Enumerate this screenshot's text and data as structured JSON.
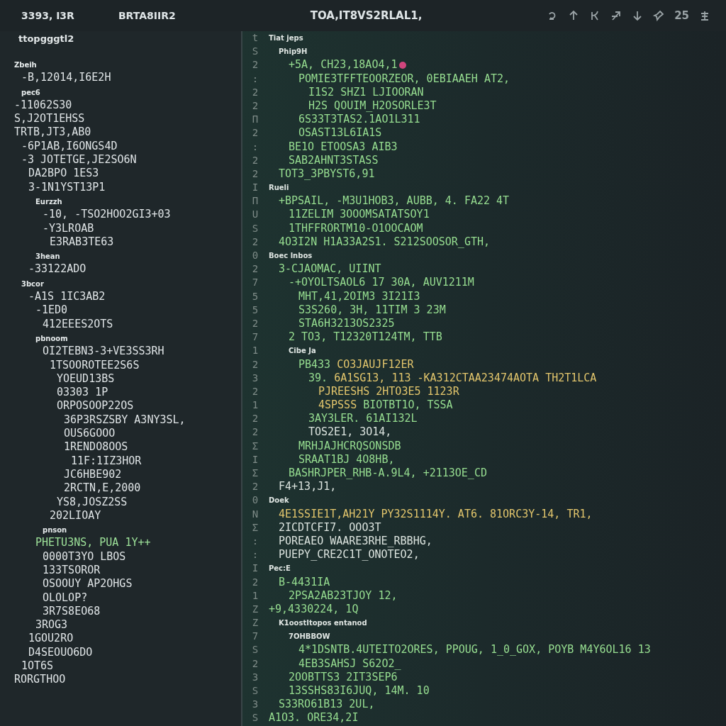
{
  "header": {
    "project": "3393, I3R",
    "branch": "BRTA8IIR2",
    "title": "TOA,IT8VS2RLAL1,",
    "count": "25"
  },
  "sidebar": {
    "subtitle": "ttopgggtl2",
    "items": [
      {
        "text": "Zbeih",
        "kind": "heading",
        "children": [
          {
            "text": "-B,12014,I6E2H",
            "kind": "line"
          },
          {
            "text": "pec6",
            "kind": "heading"
          }
        ]
      },
      {
        "text": "-11062S30",
        "kind": "line"
      },
      {
        "text": "S,J2OT1EHSS",
        "kind": "line"
      },
      {
        "text": "TRTB,JT3,AB0",
        "kind": "line",
        "children": [
          {
            "text": "-6P1AB,I6ONGS4D",
            "kind": "line"
          },
          {
            "text": "-3 JOTETGE,JE2SO6N",
            "kind": "line",
            "children": [
              {
                "text": "DA2BPO 1ES3",
                "kind": "line"
              },
              {
                "text": "3-1N1YST13P1",
                "kind": "line",
                "children": [
                  {
                    "text": "Eurzzh",
                    "kind": "heading",
                    "children": [
                      {
                        "text": "-10, -TSO2HOO2GI3+03",
                        "kind": "line"
                      },
                      {
                        "text": "-Y3LROAB",
                        "kind": "line",
                        "children": [
                          {
                            "text": "E3RAB3TE63",
                            "kind": "line"
                          }
                        ]
                      }
                    ]
                  },
                  {
                    "text": "3hean",
                    "kind": "heading"
                  }
                ]
              },
              {
                "text": "-33122ADO",
                "kind": "line"
              }
            ]
          },
          {
            "text": "3bcor",
            "kind": "heading",
            "children": [
              {
                "text": "-A1S 1IC3AB2",
                "kind": "line",
                "children": [
                  {
                    "text": "-1ED0",
                    "kind": "line",
                    "children": [
                      {
                        "text": "412EEES2OTS",
                        "kind": "line"
                      }
                    ]
                  },
                  {
                    "text": "pbnoom",
                    "kind": "heading",
                    "children": [
                      {
                        "text": "OI2TEBN3-3+VE3SS3RH",
                        "kind": "line",
                        "children": [
                          {
                            "text": "1TSOOROTEE2S6S",
                            "kind": "line",
                            "children": [
                              {
                                "text": "YOEUD13BS",
                                "kind": "line"
                              },
                              {
                                "text": "03303 1P",
                                "kind": "line"
                              },
                              {
                                "text": "ORPOSOOP22OS",
                                "kind": "line",
                                "children": [
                                  {
                                    "text": "36P3RSZSBY A3NY3SL,",
                                    "kind": "line"
                                  },
                                  {
                                    "text": "OUS6GOOO",
                                    "kind": "line"
                                  },
                                  {
                                    "text": "1RENDO8OOS",
                                    "kind": "line",
                                    "children": [
                                      {
                                        "text": "11F:1IZ3HOR",
                                        "kind": "line"
                                      }
                                    ]
                                  },
                                  {
                                    "text": "JC6HBE902",
                                    "kind": "line"
                                  },
                                  {
                                    "text": "2RCTN,E,2000",
                                    "kind": "line"
                                  }
                                ]
                              },
                              {
                                "text": "YS8,JOSZ2SS",
                                "kind": "line"
                              }
                            ]
                          },
                          {
                            "text": "202LIOAY",
                            "kind": "line"
                          }
                        ]
                      },
                      {
                        "text": "pnson",
                        "kind": "heading"
                      }
                    ]
                  },
                  {
                    "text": "PHETU3NS, PUA 1Y++",
                    "kind": "accent",
                    "children": [
                      {
                        "text": "0000T3YO LBOS",
                        "kind": "line"
                      },
                      {
                        "text": "133TSOROR",
                        "kind": "line"
                      },
                      {
                        "text": "OSOOUY AP2OHGS",
                        "kind": "line"
                      },
                      {
                        "text": "OLOLOP?",
                        "kind": "line"
                      },
                      {
                        "text": "3R7S8EO68",
                        "kind": "line"
                      }
                    ]
                  },
                  {
                    "text": "3ROG3",
                    "kind": "line"
                  }
                ]
              },
              {
                "text": "1GOU2RO",
                "kind": "line"
              },
              {
                "text": "D4SEOUO6DO",
                "kind": "line"
              }
            ]
          },
          {
            "text": "1OT6S",
            "kind": "line"
          }
        ]
      },
      {
        "text": "RORGTHOO",
        "kind": "line"
      }
    ]
  },
  "editor": {
    "lines": [
      {
        "gutter": "t",
        "kind": "heading",
        "text": "Tiat jeps",
        "children": [
          {
            "gutter": "S",
            "kind": "heading",
            "text": "Phip9H",
            "children": [
              {
                "gutter": "2",
                "kind": "code",
                "text": "+5A, CH23,18AO4,1",
                "breakpoint": true,
                "children": [
                  {
                    "gutter": ":",
                    "kind": "code",
                    "text": "POMIE3TFFTEOORZEOR, 0EBIAAEH AT2,",
                    "children": [
                      {
                        "gutter": "2",
                        "kind": "code",
                        "text": "I1S2 SHZ1 LJIOORAN"
                      },
                      {
                        "gutter": "2",
                        "kind": "code",
                        "text": "H2S QOUIM_H2OSORLE3T"
                      }
                    ]
                  },
                  {
                    "gutter": "П",
                    "kind": "code",
                    "text": "6S33T3TAS2.1AO1L311"
                  },
                  {
                    "gutter": "2",
                    "kind": "code",
                    "text": "OSAST13L6IA1S"
                  }
                ]
              },
              {
                "gutter": ":",
                "kind": "code",
                "text": "BE1O ETOOSA3 AIB3"
              },
              {
                "gutter": "2",
                "kind": "code",
                "text": "SAB2AHNT3STASS"
              }
            ]
          },
          {
            "gutter": "2",
            "kind": "code",
            "text": "TOT3_3PBYST6,91"
          }
        ]
      },
      {
        "gutter": "I",
        "kind": "heading",
        "text": "Rueli",
        "children": [
          {
            "gutter": "П",
            "kind": "code",
            "text": "+BPSAIL, -M3U1HOB3, AUBB, 4. FA22 4T",
            "children": [
              {
                "gutter": "U",
                "kind": "code",
                "text": "11ZELIM 3OOOMSATATSOY1"
              },
              {
                "gutter": "S",
                "kind": "code",
                "text": "1THFFRORTM10-O1OOCAOM"
              }
            ]
          },
          {
            "gutter": "2",
            "kind": "code",
            "text": "4O3I2N H1A33A2S1. S212SOOSOR_GTH,"
          }
        ]
      },
      {
        "gutter": "0",
        "kind": "heading",
        "text": "Boec lnbos",
        "children": [
          {
            "gutter": "2",
            "kind": "code",
            "text": "3-CJAOMAC, UIINT",
            "children": [
              {
                "gutter": "7",
                "kind": "code",
                "text": "-+OYOLTSAOL6 17 30A, AUV1211M",
                "children": [
                  {
                    "gutter": "5",
                    "kind": "code",
                    "text": "MHT,41,2OIM3 3I21I3"
                  },
                  {
                    "gutter": "5",
                    "kind": "code",
                    "text": "S3S260, 3H, 11TIM 3 23M"
                  },
                  {
                    "gutter": "2",
                    "kind": "code",
                    "text": "STA6H3213OS2325"
                  }
                ]
              },
              {
                "gutter": "7",
                "kind": "code",
                "text": "2 TO3, T12320T124TM, TTB"
              },
              {
                "gutter": "1",
                "kind": "heading",
                "text": "Cibe Ja",
                "children": [
                  {
                    "gutter": "2",
                    "kind": "mixed",
                    "tokens": [
                      {
                        "text": "PB433 ",
                        "kind": "code"
                      },
                      {
                        "text": "CO3JAUJF12ER",
                        "kind": "string"
                      }
                    ],
                    "children": [
                      {
                        "gutter": "3",
                        "kind": "mixed",
                        "tokens": [
                          {
                            "text": "39. ",
                            "kind": "code"
                          },
                          {
                            "text": "6A1SG13, 113 -KA312CTAA23474AOTA TH2T1LCA",
                            "kind": "string"
                          }
                        ],
                        "children": [
                          {
                            "gutter": "2",
                            "kind": "string",
                            "text": "PJREESHS 2HTO3E5 1123R"
                          },
                          {
                            "gutter": "1",
                            "kind": "mixed",
                            "tokens": [
                              {
                                "text": "4SPSSS ",
                                "kind": "string"
                              },
                              {
                                "text": "BIOTBT1O, TSSA",
                                "kind": "code"
                              }
                            ]
                          }
                        ]
                      },
                      {
                        "gutter": "2",
                        "kind": "code",
                        "text": "3AY3LER. 61AI132L"
                      },
                      {
                        "gutter": "2",
                        "kind": "plain",
                        "text": "TOS2E1, 3O14,"
                      }
                    ]
                  },
                  {
                    "gutter": "Σ",
                    "kind": "code",
                    "text": "MRHJAJHCRQSONSDB"
                  },
                  {
                    "gutter": "I",
                    "kind": "code",
                    "text": "SRAAT1BJ 4O8HB,"
                  }
                ]
              },
              {
                "gutter": "Σ",
                "kind": "code",
                "text": "BASHRJPER_RHB-A.9L4, +2113OE_CD"
              }
            ]
          },
          {
            "gutter": "2",
            "kind": "plain",
            "text": "F4+13,J1,"
          }
        ]
      },
      {
        "gutter": "0",
        "kind": "heading",
        "text": "Doek",
        "children": [
          {
            "gutter": "N",
            "kind": "string",
            "text": "4E1SSIE1T,AH21Y PY32S1114Y. AT6. 81ORC3Y-14, TR1,"
          },
          {
            "gutter": "Σ",
            "kind": "plain",
            "text": "2ICDTCFI7. OOO3T"
          },
          {
            "gutter": ":",
            "kind": "plain",
            "text": "POREAEO WAARE3RHE_RBBHG,"
          },
          {
            "gutter": ":",
            "kind": "plain",
            "text": "PUEPY_CRE2C1T_ONOTEO2,"
          }
        ]
      },
      {
        "gutter": "I",
        "kind": "heading",
        "text": "Pec:E",
        "children": [
          {
            "gutter": "2",
            "kind": "code",
            "text": "B-4431IA",
            "children": [
              {
                "gutter": "1",
                "kind": "code",
                "text": "2PSA2AB23TJOY 12,"
              }
            ]
          }
        ]
      },
      {
        "gutter": "Z",
        "kind": "code",
        "text": "+9,4330224, 1Q",
        "children": [
          {
            "gutter": "Z",
            "kind": "heading",
            "text": "K1oostItopos entanod",
            "children": [
              {
                "gutter": "7",
                "kind": "heading",
                "text": "7OHBBOW",
                "children": [
                  {
                    "gutter": "S",
                    "kind": "code",
                    "text": "4*1DSNTB.4UTEITO2ORES, PPOUG, 1_0_GOX, POYB M4Y6OL16 13"
                  },
                  {
                    "gutter": "2",
                    "kind": "code",
                    "text": "4EB3SAHSJ S62O2_"
                  }
                ]
              },
              {
                "gutter": "3",
                "kind": "code",
                "text": "2OOBTTS3 2IT3SEP6"
              },
              {
                "gutter": "S",
                "kind": "code",
                "text": "13SSHS83I6JUQ, 14M. 10"
              }
            ]
          },
          {
            "gutter": "3",
            "kind": "code",
            "text": "S33RO61B13 2UL,"
          }
        ]
      },
      {
        "gutter": "S",
        "kind": "code",
        "text": "A1O3. ORE34,2I"
      }
    ]
  }
}
